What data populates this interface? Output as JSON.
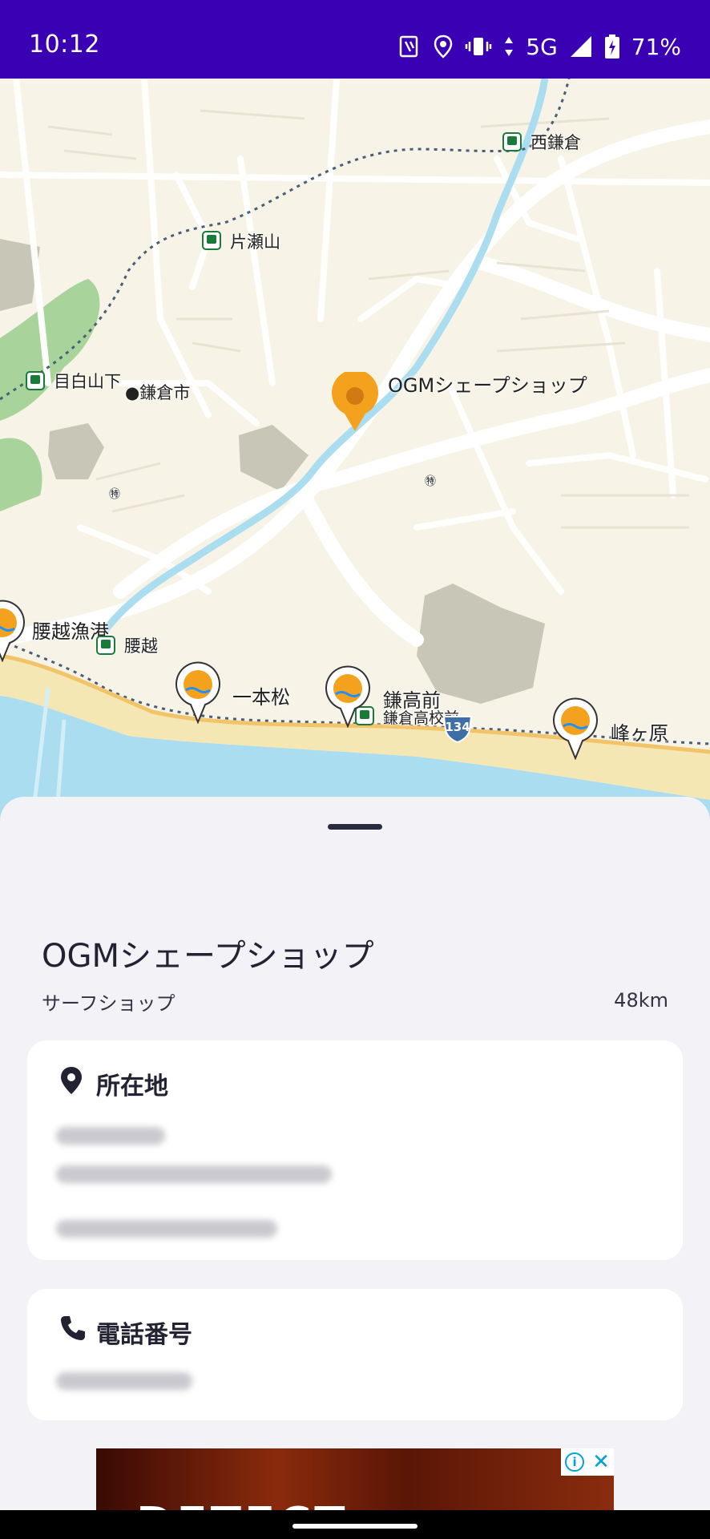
{
  "status_bar": {
    "time": "10:12",
    "network": "5G",
    "battery": "71%"
  },
  "map": {
    "labels": {
      "nishi_kamakura": "西鎌倉",
      "katasereyama": "片瀬山",
      "mejiroyamashita": "目白山下",
      "kamakura_city": "鎌倉市",
      "koshigoe_port": "腰越漁港",
      "koshigoe": "腰越",
      "ipponmatsu": "一本松",
      "kamakoumae": "鎌高前",
      "kamakura_hs": "鎌倉高校前",
      "minegahara": "峰ヶ原",
      "route_number": "134",
      "kindergarten_symbol": "㊕"
    },
    "selected_pin_label": "OGMシェープショップ",
    "colors": {
      "land": "#F7F3E6",
      "water": "#AADDF0",
      "beach": "#F5E7B4",
      "park": "#A8D39A",
      "block": "#C8C6B6",
      "pin": "#F4A21E"
    }
  },
  "sheet": {
    "title": "OGMシェープショップ",
    "category": "サーフショップ",
    "distance": "48km",
    "location_card": {
      "title": "所在地",
      "icon": "location-pin-icon"
    },
    "phone_card": {
      "title": "電話番号",
      "icon": "phone-icon"
    }
  },
  "ad": {
    "text": "DETECT",
    "info_label": "i",
    "close_label": "✕"
  }
}
